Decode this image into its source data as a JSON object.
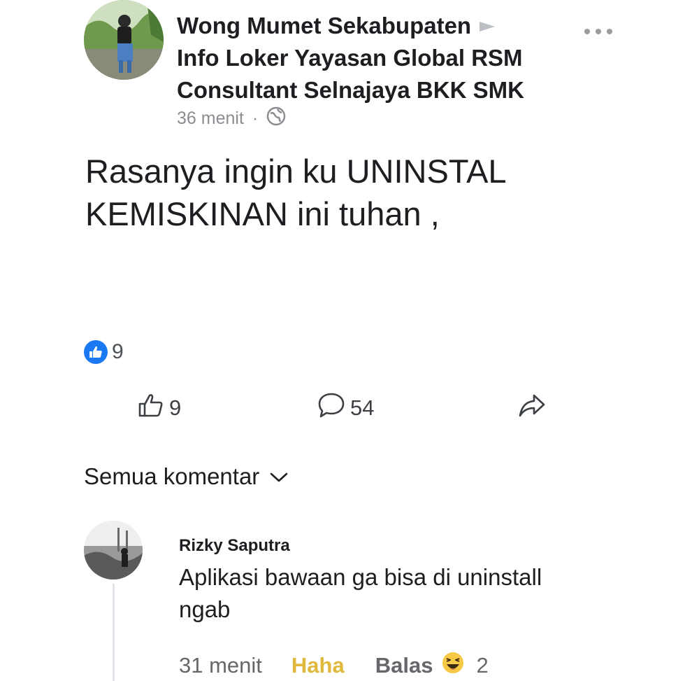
{
  "post": {
    "author_lines": [
      "Wong Mumet Sekabupaten",
      "Info Loker Yayasan Global RSM",
      "Consultant Selnajaya BKK SMK"
    ],
    "time": "36 menit",
    "separator": "·",
    "text_lines": [
      "Rasanya ingin ku UNINSTAL",
      "KEMISKINAN ini tuhan ,"
    ],
    "reaction_count": "9"
  },
  "actions": {
    "like_count": "9",
    "comment_count": "54"
  },
  "comments_filter": {
    "label": "Semua komentar"
  },
  "comment": {
    "author": "Rizky Saputra",
    "text_lines": [
      "Aplikasi bawaan ga bisa di uninstall",
      "ngab"
    ],
    "time": "31 menit",
    "reaction_label": "Haha",
    "reply_label": "Balas",
    "reaction_count": "2"
  },
  "icons": {
    "header_arrow": "play-arrow-icon",
    "more": "more-options-icon",
    "privacy": "globe-icon",
    "reaction_badge": "like-reaction-icon",
    "like": "thumbs-up-icon",
    "comment": "comment-bubble-icon",
    "share": "share-arrow-icon",
    "filter": "chevron-down-icon",
    "haha": "haha-emoji-icon"
  },
  "colors": {
    "like_blue": "#1a78f2",
    "haha_yellow": "#e0b93c",
    "muted_text": "#65676b"
  }
}
